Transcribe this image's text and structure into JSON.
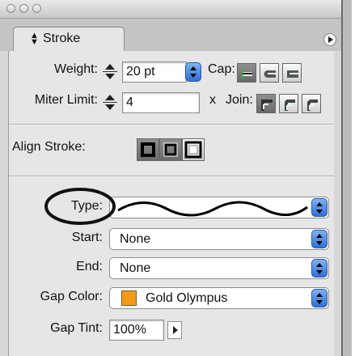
{
  "window": {
    "controls": [
      "close",
      "minimize",
      "zoom"
    ]
  },
  "tab": {
    "label": "Stroke",
    "icon": "updown-arrows-icon"
  },
  "weight": {
    "label": "Weight:",
    "value": "20 pt"
  },
  "cap": {
    "label": "Cap:",
    "options": [
      "butt-cap-icon",
      "round-cap-icon",
      "projecting-cap-icon"
    ],
    "selected": 0
  },
  "miter": {
    "label": "Miter Limit:",
    "value": "4",
    "x": "x"
  },
  "join": {
    "label": "Join:",
    "options": [
      "miter-join-icon",
      "round-join-icon",
      "bevel-join-icon"
    ],
    "selected": 0
  },
  "align": {
    "label": "Align Stroke:",
    "options": [
      "align-center-icon",
      "align-inside-icon",
      "align-outside-icon"
    ],
    "selected": 0
  },
  "type": {
    "label": "Type:",
    "value": "wavy line"
  },
  "start": {
    "label": "Start:",
    "value": "None"
  },
  "end": {
    "label": "End:",
    "value": "None"
  },
  "gap_color": {
    "label": "Gap Color:",
    "value": "Gold Olympus",
    "swatch": "#f59a16"
  },
  "gap_tint": {
    "label": "Gap Tint:",
    "value": "100%"
  },
  "colors": {
    "select_blue": "#2f6fd6",
    "annotation": "#111111"
  }
}
